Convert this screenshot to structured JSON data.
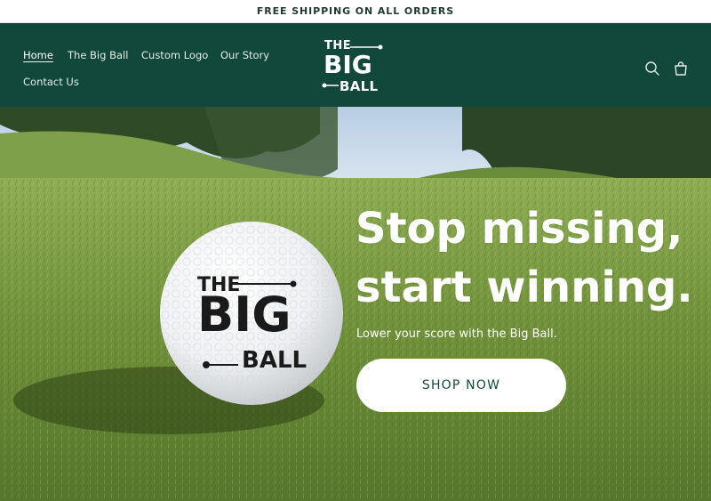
{
  "announcement": {
    "text": "FREE SHIPPING ON ALL ORDERS"
  },
  "header": {
    "nav": [
      {
        "label": "Home",
        "active": true
      },
      {
        "label": "The Big Ball",
        "active": false
      },
      {
        "label": "Custom Logo",
        "active": false
      },
      {
        "label": "Our Story",
        "active": false
      },
      {
        "label": "Contact Us",
        "active": false
      }
    ],
    "logo": {
      "line1": "THE",
      "line2": "BIG",
      "line3": "BALL"
    },
    "icons": [
      "search-icon",
      "cart-icon"
    ]
  },
  "hero": {
    "headline_line1": "Stop missing,",
    "headline_line2": "start winning.",
    "subtext": "Lower your score with the Big Ball.",
    "cta_label": "SHOP NOW",
    "ball_logo": {
      "line1": "THE",
      "line2": "BIG",
      "line3": "BALL"
    }
  },
  "colors": {
    "header_bg": "#12483b",
    "cta_text": "#12483b",
    "grass": "#6f8f3a",
    "sky": "#c9d9ea"
  }
}
